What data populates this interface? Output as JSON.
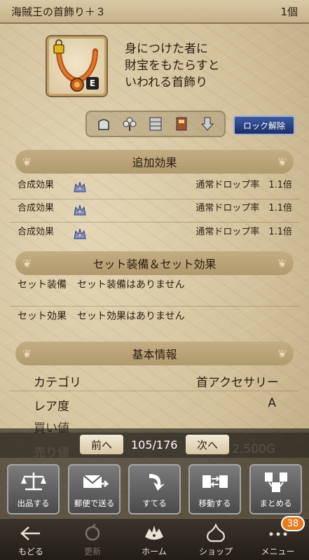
{
  "header": {
    "title": "海賊王の首飾り＋３",
    "count": "1個"
  },
  "item": {
    "equip_mark": "E",
    "description": "身につけた者に\n財宝をもたらすと\nいわれる首飾り"
  },
  "status_icons": [
    "bag-icon",
    "clover-icon",
    "storage-icon",
    "book-icon",
    "arrow-down-icon"
  ],
  "lock_button": "ロック解除",
  "sections": {
    "added": "追加効果",
    "set": "セット装備＆セット効果",
    "basic": "基本情報"
  },
  "effects": [
    {
      "label": "合成効果",
      "value": "通常ドロップ率　1.1倍"
    },
    {
      "label": "合成効果",
      "value": "通常ドロップ率　1.1倍"
    },
    {
      "label": "合成効果",
      "value": "通常ドロップ率　1.1倍"
    }
  ],
  "set_rows": [
    {
      "label": "セット装備",
      "value": "セット装備はありません"
    },
    {
      "label": "セット効果",
      "value": "セット効果はありません"
    }
  ],
  "basic": [
    {
      "label": "カテゴリ",
      "value": "首アクセサリー"
    },
    {
      "label": "レア度",
      "value": "A"
    }
  ],
  "dimmed": {
    "buy": "買い値",
    "sell": "売り値",
    "sell_value": "2,500G"
  },
  "pager": {
    "prev": "前へ",
    "count": "105/176",
    "next": "次へ"
  },
  "actions": [
    "出品する",
    "郵便で送る",
    "すてる",
    "移動する",
    "まとめる"
  ],
  "tabs": [
    "もどる",
    "更新",
    "ホーム",
    "ショップ",
    "メニュー"
  ],
  "badge": "38",
  "colors": {
    "lock_button": "#1c2e66",
    "badge": "#e57c1c",
    "section_bg": "#b19a6d"
  }
}
